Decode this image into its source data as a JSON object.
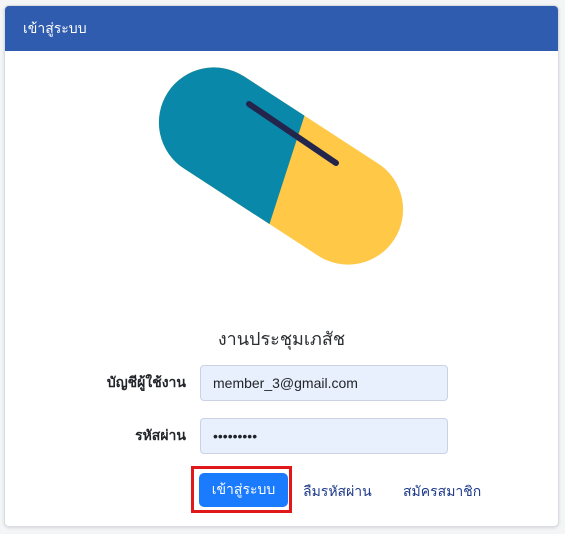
{
  "header": {
    "title": "เข้าสู่ระบบ"
  },
  "logo": {
    "icon": "pill-icon",
    "colors": {
      "left_half": "#0a88aa",
      "right_half": "#ffc847",
      "stroke": "#23254d"
    }
  },
  "org": {
    "name": "งานประชุมเภสัช"
  },
  "form": {
    "username": {
      "label": "บัญชีผู้ใช้งาน",
      "value": "member_3@gmail.com"
    },
    "password": {
      "label": "รหัสผ่าน",
      "value": "•••••••••"
    }
  },
  "actions": {
    "login_label": "เข้าสู่ระบบ",
    "forgot_password_label": "ลืมรหัสผ่าน",
    "register_label": "สมัครสมาชิก"
  },
  "colors": {
    "header_bg": "#2f5caf",
    "primary_button": "#1a7bff",
    "highlight_border": "#e0181a",
    "link": "#1d3a8a"
  }
}
